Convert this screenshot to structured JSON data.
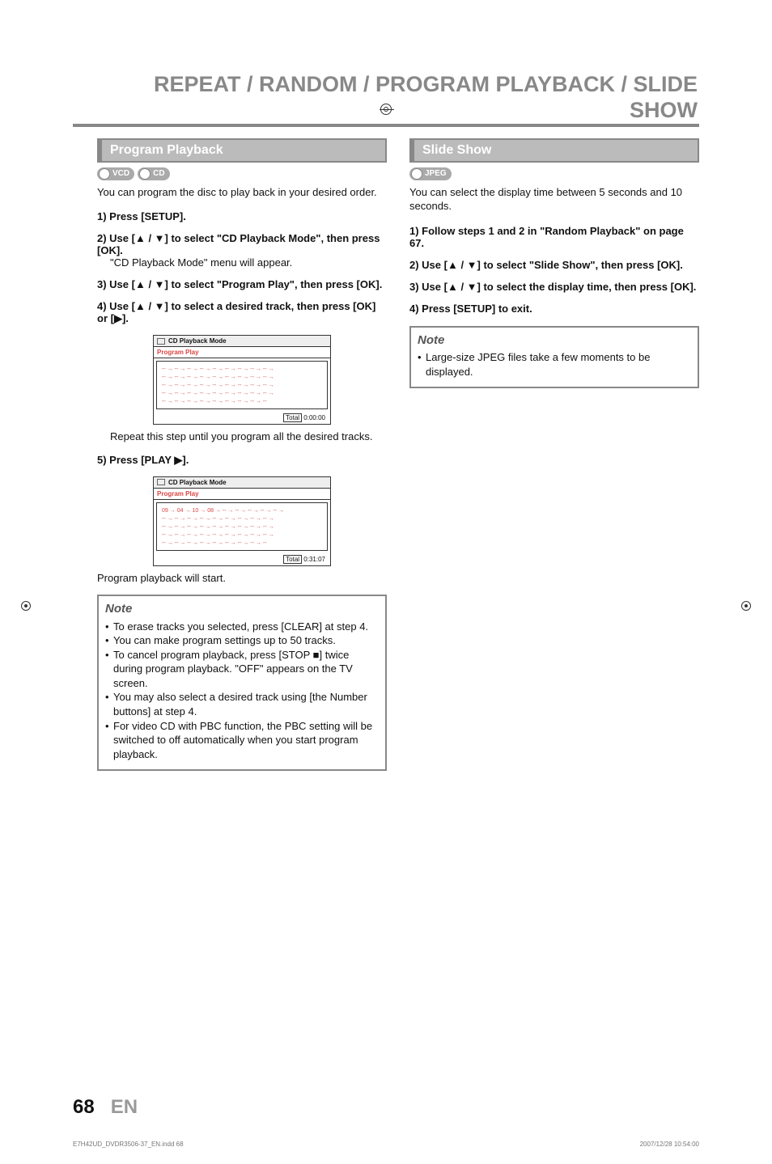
{
  "header": {
    "title": "REPEAT / RANDOM / PROGRAM PLAYBACK / SLIDE SHOW"
  },
  "left": {
    "heading": "Program Playback",
    "badges": [
      "VCD",
      "CD"
    ],
    "intro": "You can program the disc to play back in your desired order.",
    "steps": [
      {
        "head": "1) Press [SETUP].",
        "body": ""
      },
      {
        "head": "2) Use [▲ / ▼] to select \"CD Playback Mode\", then press [OK].",
        "body": "\"CD Playback Mode\" menu will appear."
      },
      {
        "head": "3) Use [▲ / ▼] to select \"Program Play\", then press [OK].",
        "body": ""
      },
      {
        "head": "4) Use [▲ / ▼] to select a desired track, then press [OK] or [▶].",
        "body": ""
      }
    ],
    "cd1": {
      "title": "CD Playback Mode",
      "sub": "Program Play",
      "rows": 5,
      "cols": 9,
      "cell": "-- →",
      "totalLabel": "Total",
      "total": "0:00:00"
    },
    "afterCd1": "Repeat this step until you program all the desired tracks.",
    "step5": {
      "head": "5) Press [PLAY ▶]."
    },
    "cd2": {
      "title": "CD Playback Mode",
      "sub": "Program Play",
      "firstRow": [
        "09 →",
        "04 →",
        "10 →",
        "08 →",
        "-- →",
        "-- →",
        "-- →",
        "-- →",
        "-- →"
      ],
      "restRows": 3,
      "cell": "-- →",
      "last": [
        "-- →",
        "-- →",
        "-- →",
        "-- →",
        "-- →",
        "-- →",
        "-- →",
        "-- →",
        "--"
      ],
      "totalLabel": "Total",
      "total": "0:31:07"
    },
    "afterCd2": "Program playback will start.",
    "note": {
      "title": "Note",
      "items": [
        "To erase tracks you selected, press [CLEAR] at step 4.",
        "You can make program settings up to 50 tracks.",
        "To cancel program playback, press [STOP ■] twice during program playback. \"OFF\" appears on the TV screen.",
        "You may also select a desired track using [the Number buttons] at step 4.",
        "For video CD with PBC function, the PBC setting will be switched to off automatically when you start program playback."
      ]
    }
  },
  "right": {
    "heading": "Slide Show",
    "badges": [
      "JPEG"
    ],
    "intro": "You can select the display time between 5 seconds and 10 seconds.",
    "steps": [
      {
        "head": "1) Follow steps 1 and 2 in \"Random Playback\" on page 67."
      },
      {
        "head": "2) Use [▲ / ▼] to select \"Slide Show\", then press [OK]."
      },
      {
        "head": "3) Use [▲ / ▼] to select the display time, then press [OK]."
      },
      {
        "head": "4) Press [SETUP] to exit."
      }
    ],
    "note": {
      "title": "Note",
      "items": [
        "Large-size JPEG files take a few moments to be displayed."
      ]
    }
  },
  "footer": {
    "page": "68",
    "lang": "EN"
  },
  "print": {
    "left": "E7H42UD_DVDR3506-37_EN.indd   68",
    "right": "2007/12/28   10:54:00"
  }
}
